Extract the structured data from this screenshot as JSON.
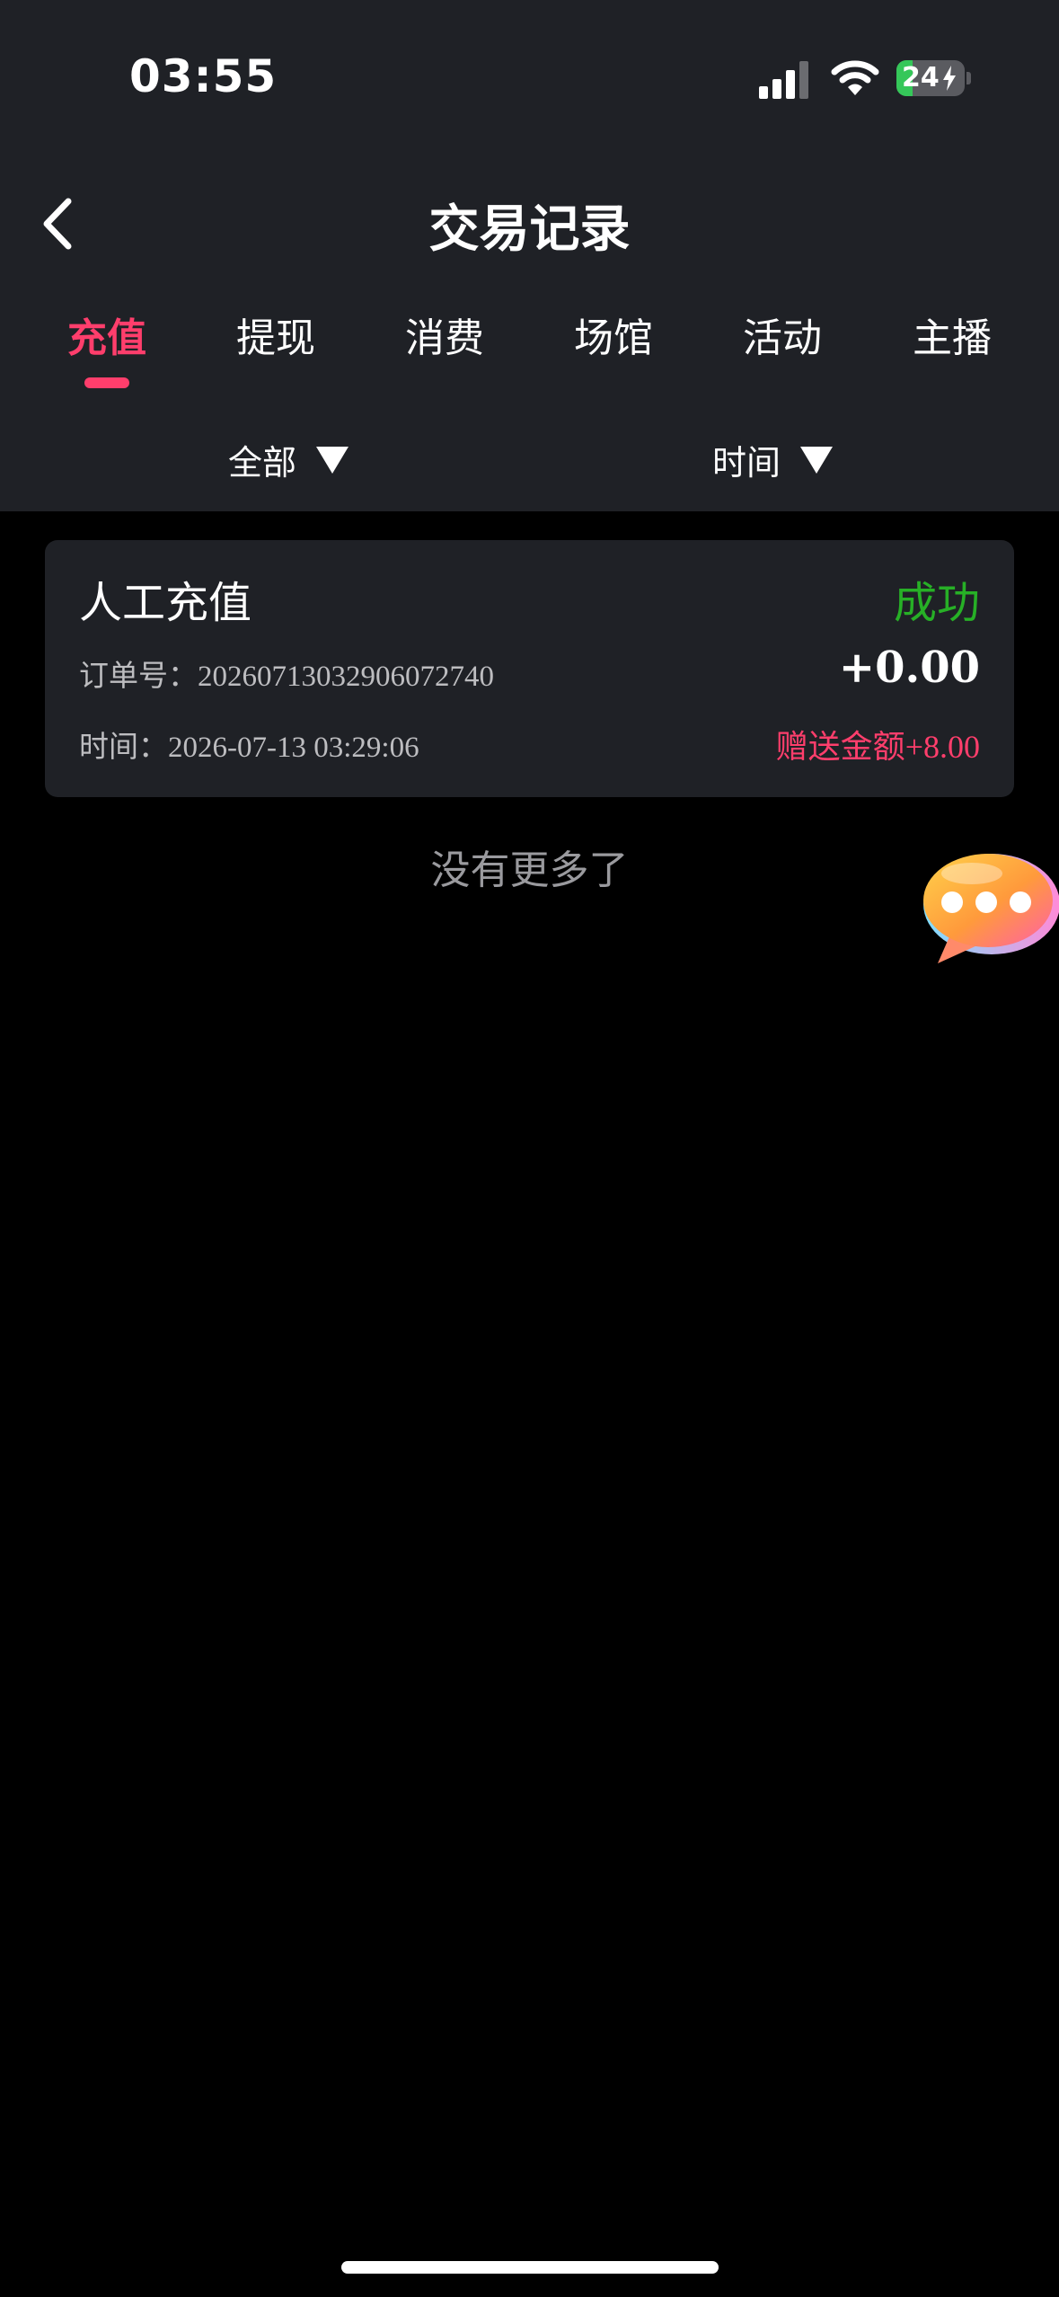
{
  "status_bar": {
    "time": "03:55",
    "battery": "24",
    "battery_level_percent": 24,
    "icons": [
      "cellular-signal-icon",
      "wifi-icon",
      "battery-charging-icon"
    ]
  },
  "header": {
    "back_icon": "chevron-left-icon",
    "title": "交易记录"
  },
  "tabs": [
    {
      "label": "充值",
      "active": true
    },
    {
      "label": "提现",
      "active": false
    },
    {
      "label": "消费",
      "active": false
    },
    {
      "label": "场馆",
      "active": false
    },
    {
      "label": "活动",
      "active": false
    },
    {
      "label": "主播",
      "active": false
    }
  ],
  "filters": {
    "type_label": "全部",
    "time_label": "时间",
    "dropdown_icon": "triangle-down-icon"
  },
  "records": [
    {
      "title": "人工充值",
      "status": "成功",
      "order_prefix": "订单号：",
      "order_no": "20260713032906072740",
      "amount": "+0.00",
      "time_prefix": "时间：",
      "time": "2026-07-13 03:29:06",
      "bonus_label": "赠送金额",
      "bonus_value": "+8.00"
    }
  ],
  "list_end_text": "没有更多了",
  "floating_button_icon": "chat-bubble-icon",
  "colors": {
    "accent": "#ff3e6c",
    "success": "#27b026",
    "header_bg": "#1f2126",
    "card_bg": "#1f2126",
    "page_bg": "#000000"
  }
}
